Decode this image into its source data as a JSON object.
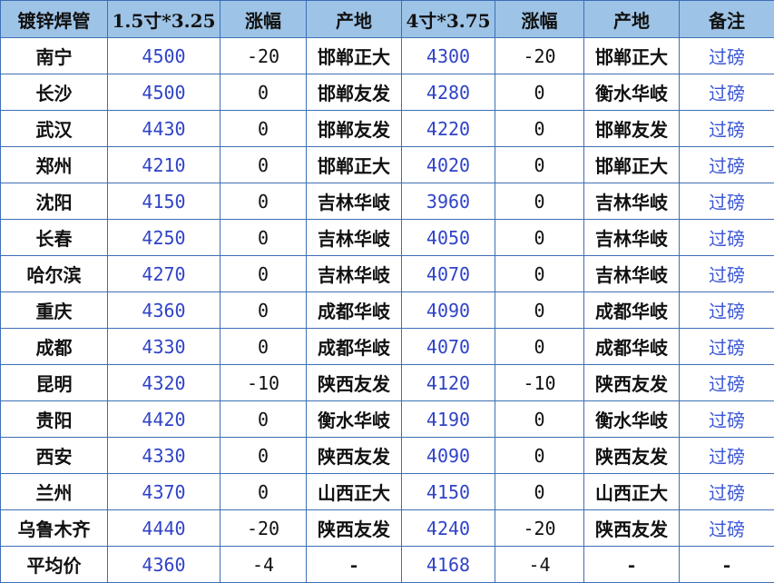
{
  "table": {
    "headers": [
      "镀锌焊管",
      "1.5寸*3.25",
      "涨幅",
      "产地",
      "4寸*3.75",
      "涨幅",
      "产地",
      "备注"
    ],
    "rows": [
      [
        "南宁",
        "4500",
        "-20",
        "邯郸正大",
        "4300",
        "-20",
        "邯郸正大",
        "过磅"
      ],
      [
        "长沙",
        "4500",
        "0",
        "邯郸友发",
        "4280",
        "0",
        "衡水华岐",
        "过磅"
      ],
      [
        "武汉",
        "4430",
        "0",
        "邯郸友发",
        "4220",
        "0",
        "邯郸友发",
        "过磅"
      ],
      [
        "郑州",
        "4210",
        "0",
        "邯郸正大",
        "4020",
        "0",
        "邯郸正大",
        "过磅"
      ],
      [
        "沈阳",
        "4150",
        "0",
        "吉林华岐",
        "3960",
        "0",
        "吉林华岐",
        "过磅"
      ],
      [
        "长春",
        "4250",
        "0",
        "吉林华岐",
        "4050",
        "0",
        "吉林华岐",
        "过磅"
      ],
      [
        "哈尔滨",
        "4270",
        "0",
        "吉林华岐",
        "4070",
        "0",
        "吉林华岐",
        "过磅"
      ],
      [
        "重庆",
        "4360",
        "0",
        "成都华岐",
        "4090",
        "0",
        "成都华岐",
        "过磅"
      ],
      [
        "成都",
        "4330",
        "0",
        "成都华岐",
        "4070",
        "0",
        "成都华岐",
        "过磅"
      ],
      [
        "昆明",
        "4320",
        "-10",
        "陕西友发",
        "4120",
        "-10",
        "陕西友发",
        "过磅"
      ],
      [
        "贵阳",
        "4420",
        "0",
        "衡水华岐",
        "4190",
        "0",
        "衡水华岐",
        "过磅"
      ],
      [
        "西安",
        "4330",
        "0",
        "陕西友发",
        "4090",
        "0",
        "陕西友发",
        "过磅"
      ],
      [
        "兰州",
        "4370",
        "0",
        "山西正大",
        "4150",
        "0",
        "山西正大",
        "过磅"
      ],
      [
        "乌鲁木齐",
        "4440",
        "-20",
        "陕西友发",
        "4240",
        "-20",
        "陕西友发",
        "过磅"
      ],
      [
        "平均价",
        "4360",
        "-4",
        "-",
        "4168",
        "-4",
        "-",
        "-"
      ]
    ]
  },
  "colors": {
    "header_bg": "#9dc3e6",
    "border": "#3d6fb6",
    "price_text": "#2f43c7",
    "link_text": "#3a56d6"
  }
}
